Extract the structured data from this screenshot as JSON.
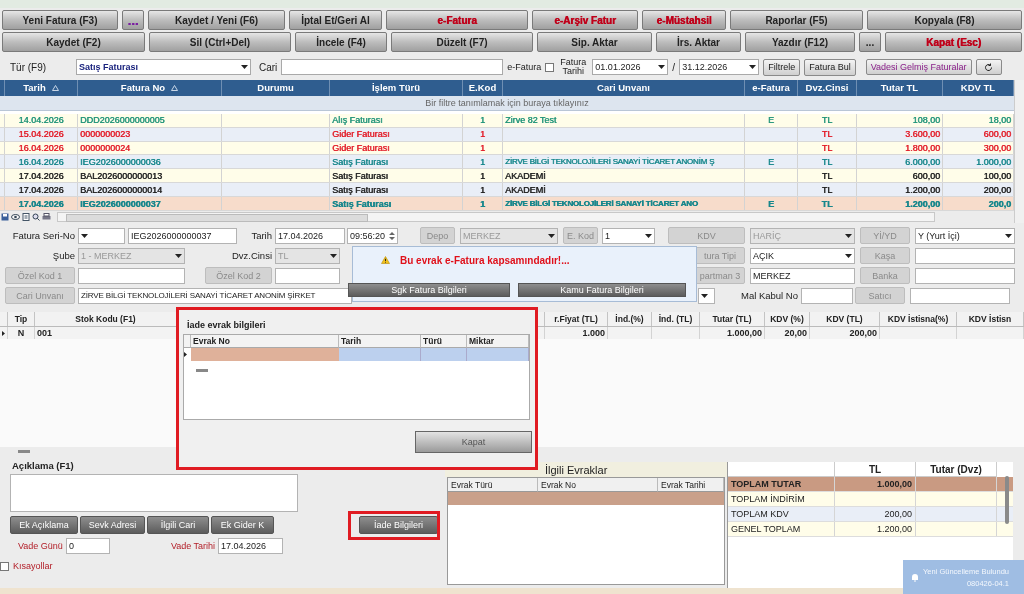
{
  "toolbar": {
    "row_1": [
      {
        "label": "Yeni Fatura (F3)"
      },
      {
        "label": "...",
        "color": "#7b1fa2"
      },
      {
        "label": "Kaydet / Yeni (F6)"
      },
      {
        "label": "İptal Et/Geri Al"
      },
      {
        "label": "e-Fatura",
        "color": "#c0001a"
      },
      {
        "label": "e-Arşiv Fatur",
        "color": "#c0001a"
      },
      {
        "label": "e-Müstahsil",
        "color": "#c0001a"
      },
      {
        "label": "Raporlar (F5)"
      },
      {
        "label": "Kopyala (F8)"
      }
    ],
    "row_2": [
      {
        "label": "Kaydet (F2)"
      },
      {
        "label": "Sil (Ctrl+Del)"
      },
      {
        "label": "İncele (F4)"
      },
      {
        "label": "Düzelt (F7)"
      },
      {
        "label": "Sip. Aktar"
      },
      {
        "label": "İrs. Aktar"
      },
      {
        "label": "Yazdır (F12)"
      },
      {
        "label": "..."
      },
      {
        "label": "Kapat (Esc)",
        "color": "#c0001a"
      }
    ]
  },
  "filter": {
    "type_label": "Tür (F9)",
    "type_value": "Satış Faturası",
    "cari_label": "Cari",
    "efatura_label": "e-Fatura",
    "efatura_checked": false,
    "date_label": "Fatura Tarihi",
    "date_from": "01.01.2026",
    "separator": "/",
    "date_to": "31.12.2026",
    "buttons": [
      "Filtrele",
      "Fatura Bul"
    ],
    "due_button": "Vadesi Gelmiş Faturalar"
  },
  "grid": {
    "columns": [
      {
        "label": "Tarih",
        "sorted": true
      },
      {
        "label": "Fatura No",
        "sorted": true
      },
      {
        "label": "Durumu",
        "sorted": false
      },
      {
        "label": "İşlem Türü",
        "sorted": false
      },
      {
        "label": "E.Kod",
        "sorted": false
      },
      {
        "label": "Cari Unvanı",
        "sorted": false
      },
      {
        "label": "e-Fatura",
        "sorted": false
      },
      {
        "label": "Dvz.Cinsi",
        "sorted": false
      },
      {
        "label": "Tutar TL",
        "sorted": false
      },
      {
        "label": "KDV TL",
        "sorted": false
      }
    ],
    "filter_hint": "Bir filtre tanımlamak için buraya tıklayınız",
    "rows": [
      {
        "tarih": "14.04.2026",
        "fatura_no": "DDD2026000000005",
        "islem_turu": "Alış Faturası",
        "e_kod": "1",
        "cari_unvani": "Zirve 82 Test",
        "e_fatura": "E",
        "dvz": "TL",
        "tutar": "108,00",
        "kdv": "18,00",
        "color": "#23957a",
        "selected": false
      },
      {
        "tarih": "15.04.2026",
        "fatura_no": "0000000023",
        "islem_turu": "Gider Faturası",
        "e_kod": "1",
        "dvz": "TL",
        "tutar": "3.600,00",
        "kdv": "600,00",
        "color": "#e3202c",
        "selected": false
      },
      {
        "tarih": "16.04.2026",
        "fatura_no": "0000000024",
        "islem_turu": "Gider Faturası",
        "e_kod": "1",
        "dvz": "TL",
        "tutar": "1.800,00",
        "kdv": "300,00",
        "color": "#e3202c",
        "selected": false
      },
      {
        "tarih": "16.04.2026",
        "fatura_no": "IEG2026000000036",
        "islem_turu": "Satış Faturası",
        "e_kod": "1",
        "cari_unvani": "ZİRVE BİLGİ TEKNOLOJİLERİ SANAYİ TİCARET ANONİM Ş",
        "e_fatura": "E",
        "dvz": "TL",
        "tutar": "6.000,00",
        "kdv": "1.000,00",
        "color": "#17878c",
        "selected": false
      },
      {
        "tarih": "17.04.2026",
        "fatura_no": "BAL2026000000013",
        "islem_turu": "Satış Faturası",
        "e_kod": "1",
        "cari_unvani": "AKADEMİ",
        "dvz": "TL",
        "tutar": "600,00",
        "kdv": "100,00",
        "color": "#222222",
        "selected": false
      },
      {
        "tarih": "17.04.2026",
        "fatura_no": "BAL2026000000014",
        "islem_turu": "Satış Faturası",
        "e_kod": "1",
        "cari_unvani": "AKADEMİ",
        "dvz": "TL",
        "tutar": "1.200,00",
        "kdv": "200,00",
        "color": "#222222",
        "selected": false
      },
      {
        "tarih": "17.04.2026",
        "fatura_no": "IEG2026000000037",
        "islem_turu": "Satış Faturası",
        "e_kod": "1",
        "cari_unvani": "ZİRVE BİLGİ TEKNOLOJİLERİ SANAYİ TİCARET ANO",
        "e_fatura": "E",
        "dvz": "TL",
        "tutar": "1.200,00",
        "kdv": "200,0",
        "color": "#17878c",
        "selected": true
      }
    ]
  },
  "form": [
    [
      {
        "kind": "label",
        "text": "Fatura Seri-No"
      },
      {
        "kind": "select",
        "disabled": false
      },
      {
        "kind": "input",
        "value": "IEG2026000000037"
      },
      {
        "kind": "label",
        "text": "Tarih"
      },
      {
        "kind": "input",
        "value": "17.04.2026"
      },
      {
        "kind": "time",
        "value": "09:56:20"
      },
      {
        "kind": "button",
        "text": "Depo"
      },
      {
        "kind": "select",
        "value": "MERKEZ",
        "disabled": true
      },
      {
        "kind": "button",
        "text": "E. Kod"
      },
      {
        "kind": "select",
        "value": "1",
        "disabled": false
      },
      {
        "kind": "button",
        "text": "KDV"
      },
      {
        "kind": "select",
        "value": "HARİÇ",
        "disabled": true
      },
      {
        "kind": "button",
        "text": "Yİ/YD"
      },
      {
        "kind": "select",
        "value": "Y (Yurt İçi)",
        "disabled": false
      }
    ],
    [
      {
        "kind": "label",
        "text": "Şube"
      },
      {
        "kind": "select",
        "value": "1 - MERKEZ",
        "disabled": true
      },
      {
        "kind": "label",
        "text": "Dvz.Cinsi"
      },
      {
        "kind": "select",
        "value": "TL",
        "disabled": true
      },
      {
        "kind": "button",
        "text": "tura Tipi"
      },
      {
        "kind": "select",
        "value": "AÇIK",
        "disabled": false
      },
      {
        "kind": "button",
        "text": "Kaşa"
      },
      {
        "kind": "input"
      }
    ],
    [
      {
        "kind": "button",
        "text": "Özel Kod 1"
      },
      {
        "kind": "input"
      },
      {
        "kind": "button",
        "text": "Özel Kod 2"
      },
      {
        "kind": "input"
      },
      {
        "kind": "button",
        "text": "partman 3"
      },
      {
        "kind": "input",
        "value": "MERKEZ"
      },
      {
        "kind": "button",
        "text": "Banka"
      },
      {
        "kind": "input"
      }
    ],
    [
      {
        "kind": "button",
        "text": "Cari Unvanı"
      },
      {
        "kind": "input",
        "value": "ZİRVE BİLGİ TEKNOLOJİLERİ SANAYİ TİCARET ANONİM ŞİRKET"
      },
      {
        "kind": "select",
        "disabled": false
      },
      {
        "kind": "label",
        "text": "Mal Kabul No"
      },
      {
        "kind": "input"
      },
      {
        "kind": "button",
        "text": "Satıcı"
      },
      {
        "kind": "input"
      }
    ]
  ],
  "efatura_popup": {
    "message": "Bu evrak e-Fatura kapsamındadır!...",
    "buttons": [
      "Sgk Fatura Bilgileri",
      "Kamu Fatura Bilgileri"
    ]
  },
  "detail": {
    "columns": [
      "Tip",
      "Stok Kodu (F1)",
      "r.Fiyat (TL)",
      "İnd.(%)",
      "İnd. (TL)",
      "Tutar (TL)",
      "KDV (%)",
      "KDV (TL)",
      "KDV İstisna(%)",
      "KDV İstisn"
    ],
    "rows": [
      {
        "tip": "N",
        "stok_kodu": "001",
        "birim_fiyat": "1.000",
        "tutar": "1.000,00",
        "kdv_orani": "20,00",
        "kdv_tutari": "200,00"
      }
    ]
  },
  "iade_dialog": {
    "title": "İade evrak bilgileri",
    "columns": [
      "Evrak No",
      "Tarih",
      "Türü",
      "Miktar"
    ],
    "close_button": "Kapat"
  },
  "bottom": {
    "aciklama_label": "Açıklama (F1)",
    "buttons": [
      "Ek Açıklama",
      "Sevk Adresi",
      "İlgili Cari",
      "Ek Gider K"
    ],
    "iade_button": "İade Bilgileri",
    "vade_gunu_label": "Vade Günü",
    "vade_gunu": "0",
    "vade_tarihi_label": "Vade Tarihi",
    "vade_tarihi": "17.04.2026",
    "shortcuts": {
      "label": "Kısayollar",
      "checked": false
    }
  },
  "related": {
    "title": "İlgili Evraklar",
    "columns": [
      "Evrak Türü",
      "Evrak No",
      "Evrak Tarihi"
    ]
  },
  "totals": {
    "columns": [
      "TL",
      "Tutar (Dvz)"
    ],
    "rows": [
      {
        "label": "TOPLAM TUTAR",
        "tl": "1.000,00",
        "selected": true
      },
      {
        "label": "TOPLAM İNDİRİM",
        "selected": false
      },
      {
        "label": "TOPLAM KDV",
        "tl": "200,00",
        "selected": false
      },
      {
        "label": "GENEL TOPLAM",
        "tl": "1.200,00",
        "selected": false
      }
    ]
  },
  "notification": {
    "title": "Yeni Güncelleme Bulundu",
    "version": "080426-04.1"
  }
}
